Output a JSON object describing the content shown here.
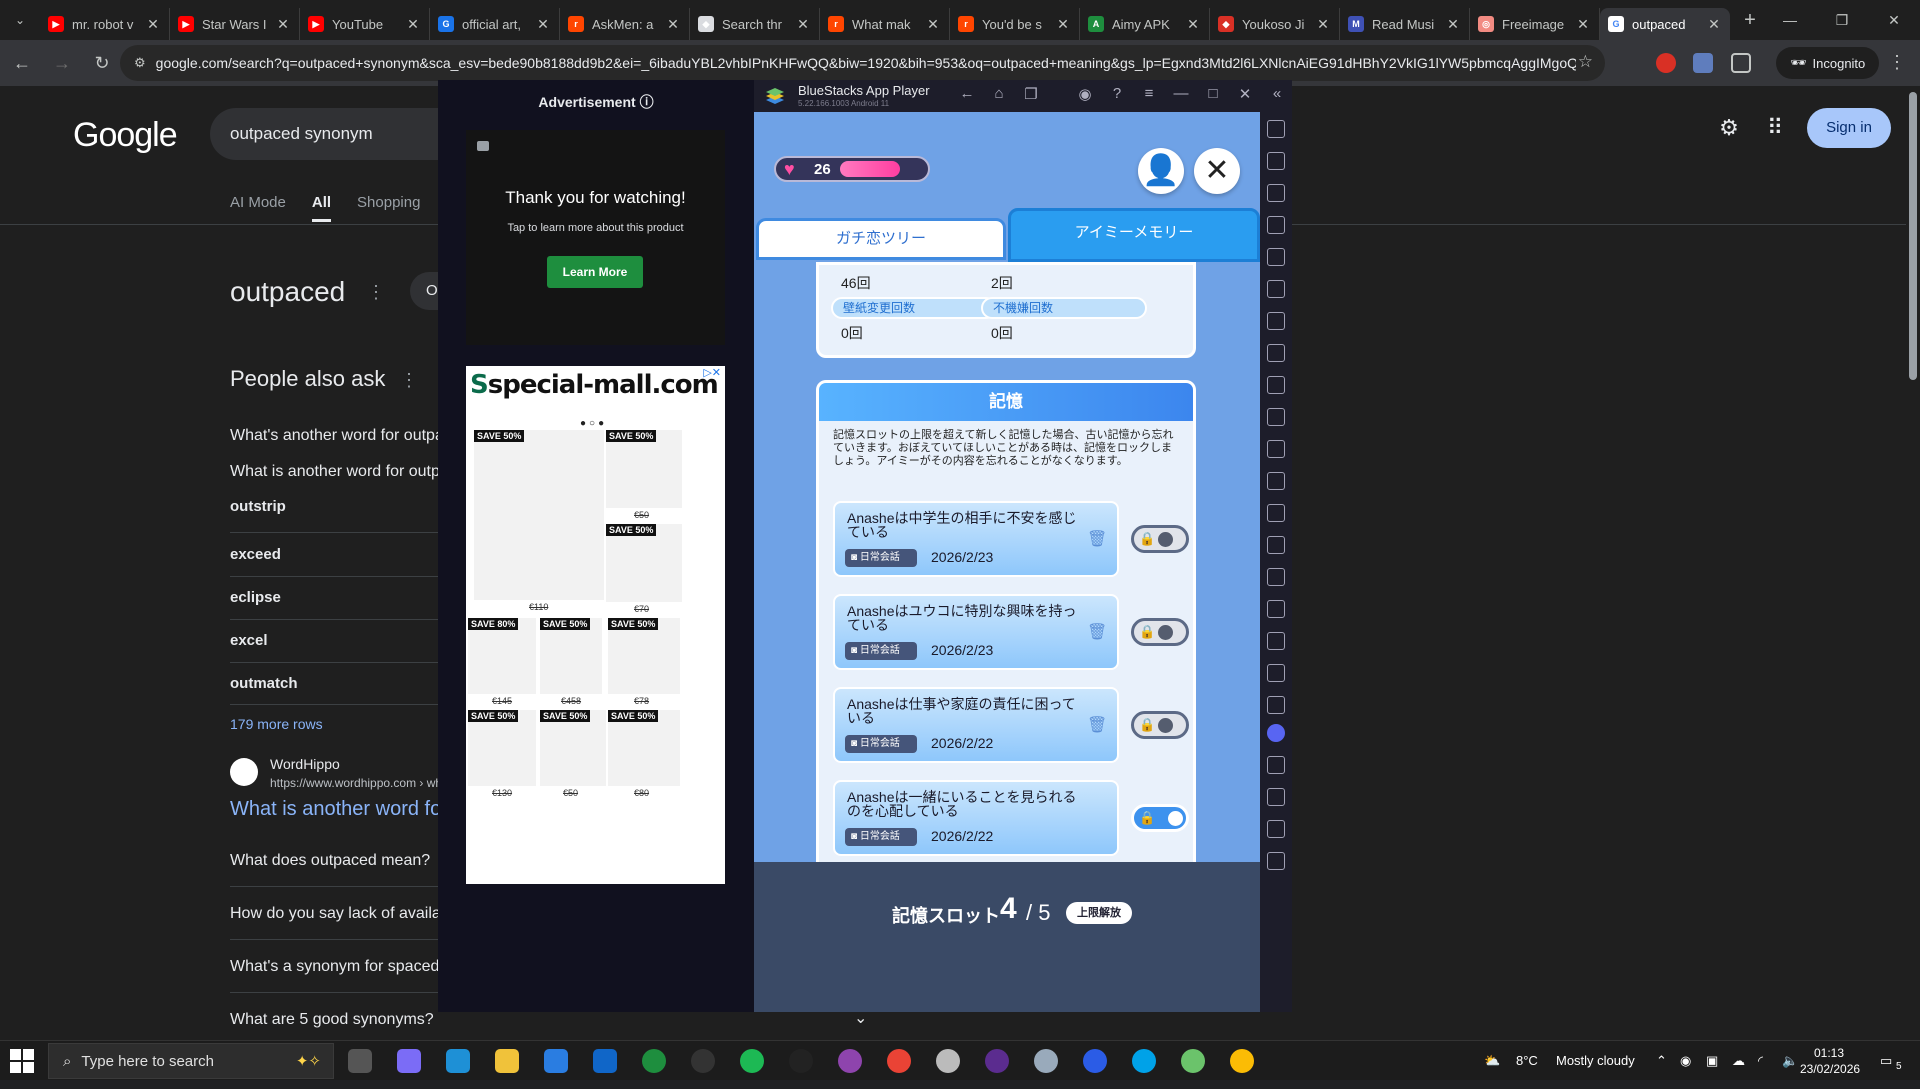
{
  "browser": {
    "tabs": [
      {
        "title": "mr. robot v",
        "fav_color": "#ff0000",
        "fav_glyph": "▶"
      },
      {
        "title": "Star Wars I",
        "fav_color": "#ff0000",
        "fav_glyph": "▶"
      },
      {
        "title": "YouTube",
        "fav_color": "#ff0000",
        "fav_glyph": "▶"
      },
      {
        "title": "official art,",
        "fav_color": "#1a73e8",
        "fav_glyph": "G"
      },
      {
        "title": "AskMen: a",
        "fav_color": "#ff4500",
        "fav_glyph": "r"
      },
      {
        "title": "Search thr",
        "fav_color": "#dadce0",
        "fav_glyph": "◆"
      },
      {
        "title": "What mak",
        "fav_color": "#ff4500",
        "fav_glyph": "r"
      },
      {
        "title": "You'd be s",
        "fav_color": "#ff4500",
        "fav_glyph": "r"
      },
      {
        "title": "Aimy APK",
        "fav_color": "#1e8e3e",
        "fav_glyph": "A"
      },
      {
        "title": "Youkoso Ji",
        "fav_color": "#d93025",
        "fav_glyph": "◆"
      },
      {
        "title": "Read Musi",
        "fav_color": "#3f51b5",
        "fav_glyph": "M"
      },
      {
        "title": "Freeimage",
        "fav_color": "#f28b82",
        "fav_glyph": "◎"
      },
      {
        "title": "outpaced",
        "fav_color": "#ffffff",
        "fav_glyph": "G",
        "active": true
      }
    ],
    "url": "google.com/search?q=outpaced+synonym&sca_esv=bede90b8188dd9b2&ei=_6ibaduYBL2vhbIPnKHFwQQ&biw=1920&bih=953&oq=outpaced+meaning&gs_lp=Egxnd3Mtd2l6LXNlcnAiEG91dHBhY2VkIG1lYW5pbmcqAggIMgoQA...",
    "incognito_label": "Incognito"
  },
  "google": {
    "logo": "Google",
    "query": "outpaced synonym",
    "tabs": [
      "AI Mode",
      "All",
      "Shopping"
    ],
    "active_tab": "All",
    "sign_in": "Sign in",
    "word": "outpaced",
    "pill": "O",
    "paa_title": "People also ask",
    "questions_top": [
      "What's another word for outpaced?",
      "What is another word for outpace?"
    ],
    "synonyms": [
      "outstrip",
      "exceed",
      "eclipse",
      "excel",
      "outmatch"
    ],
    "more_rows": "179 more rows",
    "source_name": "WordHippo",
    "source_url": "https://www.wordhippo.com › what-is",
    "result_title": "What is another word for outpaced?",
    "questions_bottom": [
      "What does outpaced mean?",
      "How do you say lack of availability?",
      "What's a synonym for spaced?",
      "What are 5 good synonyms?"
    ]
  },
  "ads": {
    "header": "Advertisement ⓘ",
    "ad1_title": "Thank you for watching!",
    "ad1_sub": "Tap to learn more about this product",
    "ad1_button": "Learn More",
    "ad2_logo": "special-mall.com",
    "ad2_logo_mark": "S",
    "products": [
      {
        "save": "SAVE 50%",
        "price": "€110"
      },
      {
        "save": "SAVE 50%",
        "price": "€50"
      },
      {
        "save": "SAVE 50%",
        "price": "€70"
      },
      {
        "save": "SAVE 80%",
        "price": "€145"
      },
      {
        "save": "SAVE 50%",
        "price": "€458"
      },
      {
        "save": "SAVE 50%",
        "price": "€78"
      },
      {
        "save": "SAVE 50%",
        "price": "€130"
      },
      {
        "save": "SAVE 50%",
        "price": "€50"
      },
      {
        "save": "SAVE 50%",
        "price": "€80"
      }
    ]
  },
  "bluestacks": {
    "title": "BlueStacks App Player",
    "version": "5.22.166.1003  Android 11",
    "game": {
      "hearts": "26",
      "tab_left": "ガチ恋ツリー",
      "tab_right": "アイミーメモリー",
      "stats": [
        {
          "label": "",
          "value": "46回"
        },
        {
          "label": "",
          "value": "2回"
        },
        {
          "label": "壁紙変更回数",
          "value": "0回"
        },
        {
          "label": "不機嫌回数",
          "value": "0回"
        }
      ],
      "memory_title": "記憶",
      "memory_desc": "記憶スロットの上限を超えて新しく記憶した場合、古い記憶から忘れていきます。おぼえていてほしいことがある時は、記憶をロックしましょう。アイミーがその内容を忘れることがなくなります。",
      "memories": [
        {
          "text": "Anasheは中学生の相手に不安を感じている",
          "tag": "日常会話",
          "date": "2026/2/23",
          "locked": false
        },
        {
          "text": "Anasheはユウコに特別な興味を持っている",
          "tag": "日常会話",
          "date": "2026/2/23",
          "locked": false
        },
        {
          "text": "Anasheは仕事や家庭の責任に困っている",
          "tag": "日常会話",
          "date": "2026/2/22",
          "locked": false
        },
        {
          "text": "Anasheは一緒にいることを見られるのを心配している",
          "tag": "日常会話",
          "date": "2026/2/22",
          "locked": true
        }
      ],
      "slot_label": "記憶スロット",
      "slot_used": "4",
      "slot_total": "/ 5",
      "slot_upgrade": "上限解放"
    }
  },
  "taskbar": {
    "search_placeholder": "Type here to search",
    "weather_temp": "8°C",
    "weather_desc": "Mostly cloudy",
    "time": "01:13",
    "date": "23/02/2026",
    "notifications": "5"
  }
}
